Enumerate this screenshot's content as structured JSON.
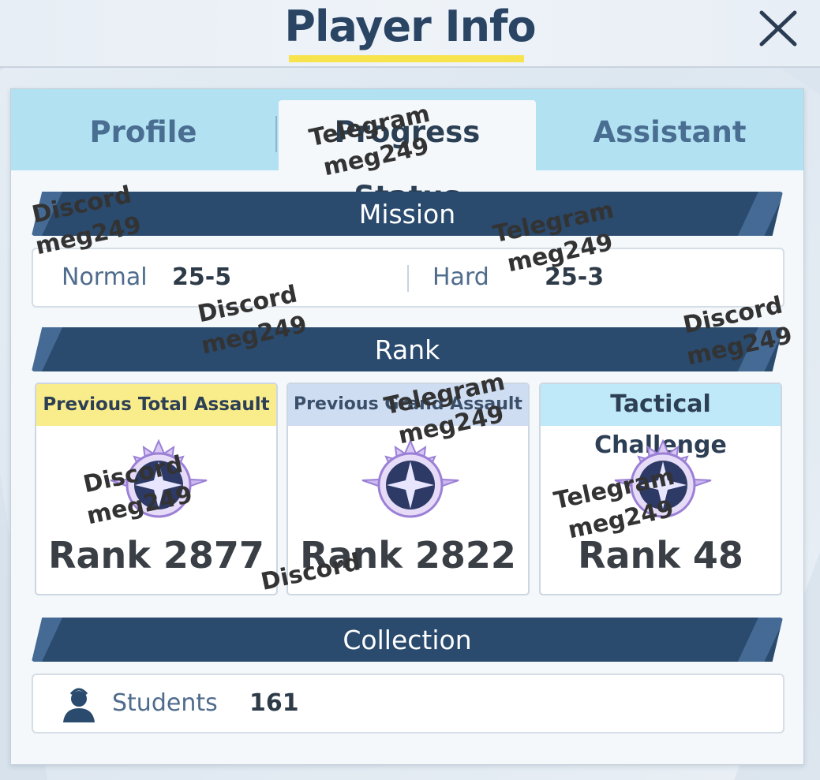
{
  "header": {
    "title": "Player Info",
    "close_icon": "close-icon"
  },
  "tabs": [
    {
      "label": "Profile",
      "active": false
    },
    {
      "label": "Progress Status",
      "active": true
    },
    {
      "label": "Assistant",
      "active": false
    }
  ],
  "mission": {
    "heading": "Mission",
    "normal_label": "Normal",
    "normal_value": "25-5",
    "hard_label": "Hard",
    "hard_value": "25-3"
  },
  "rank": {
    "heading": "Rank",
    "cards": [
      {
        "caption": "Previous Total Assault",
        "caption_color": "#f9ec8a",
        "value": "Rank 2877",
        "icon": "rank-emblem-icon"
      },
      {
        "caption": "Previous Grand Assault",
        "caption_color": "#cfddf2",
        "value": "Rank 2822",
        "icon": "rank-emblem-icon"
      },
      {
        "caption": "Tactical Challenge",
        "caption_color": "#bfe8f8",
        "value": "Rank 48",
        "icon": "rank-emblem-icon"
      }
    ]
  },
  "collection": {
    "heading": "Collection",
    "students_label": "Students",
    "students_value": "161",
    "icon": "student-icon"
  },
  "watermarks": [
    {
      "line1": "Telegram",
      "line2": "meg249"
    },
    {
      "line1": "Discord",
      "line2": "meg249"
    },
    {
      "line1": "Telegram",
      "line2": "meg249"
    },
    {
      "line1": "Discord",
      "line2": "meg249"
    },
    {
      "line1": "Discord",
      "line2": "meg249"
    },
    {
      "line1": "Telegram",
      "line2": "meg249"
    },
    {
      "line1": "Discord",
      "line2": "meg249"
    },
    {
      "line1": "Telegram",
      "line2": "meg249"
    },
    {
      "line1": "Discord",
      "line2": ""
    }
  ],
  "colors": {
    "title": "#2a4464",
    "accent_underline": "#f7e34c",
    "tab_bar": "#b2e1f2",
    "section_bar": "#2a4a6e"
  }
}
